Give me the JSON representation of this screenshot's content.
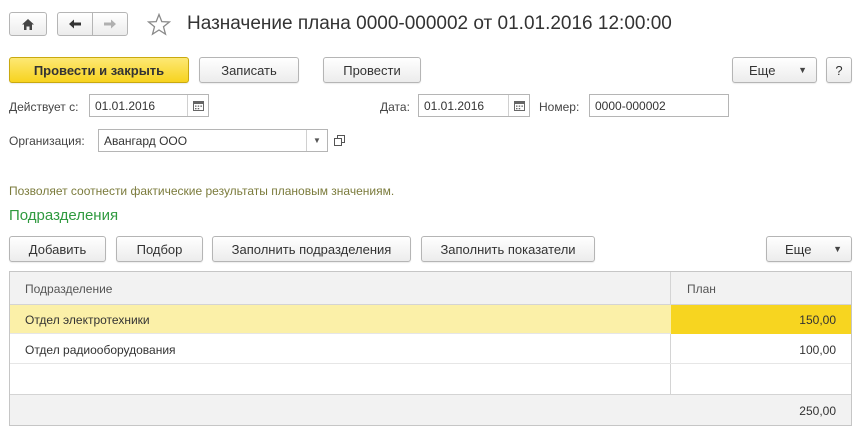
{
  "header": {
    "title": "Назначение плана 0000-000002 от 01.01.2016 12:00:00",
    "icons": {
      "home": "home-icon",
      "back": "arrow-left-icon",
      "forward": "arrow-right-icon",
      "favorite": "star-icon"
    }
  },
  "toolbar": {
    "post_close_label": "Провести и закрыть",
    "save_label": "Записать",
    "post_label": "Провести",
    "more_label": "Еще",
    "help_label": "?"
  },
  "form": {
    "valid_from_label": "Действует с:",
    "valid_from_value": "01.01.2016",
    "date_label": "Дата:",
    "date_value": "01.01.2016",
    "number_label": "Номер:",
    "number_value": "0000-000002",
    "org_label": "Организация:",
    "org_value": "Авангард ООО"
  },
  "hint_text": "Позволяет соотнести фактические результаты плановым значениям.",
  "section_title": "Подразделения",
  "table_toolbar": {
    "add_label": "Добавить",
    "pick_label": "Подбор",
    "fill_depts_label": "Заполнить подразделения",
    "fill_metrics_label": "Заполнить показатели",
    "more_label": "Еще"
  },
  "table": {
    "columns": [
      "Подразделение",
      "План"
    ],
    "rows": [
      {
        "dept": "Отдел электротехники",
        "plan": "150,00"
      },
      {
        "dept": "Отдел радиооборудования",
        "plan": "100,00"
      }
    ],
    "total": "250,00"
  },
  "colors": {
    "accent_yellow": "#f7d31f",
    "section_green": "#2f9a3f",
    "selected_row": "#fbf0a8"
  }
}
